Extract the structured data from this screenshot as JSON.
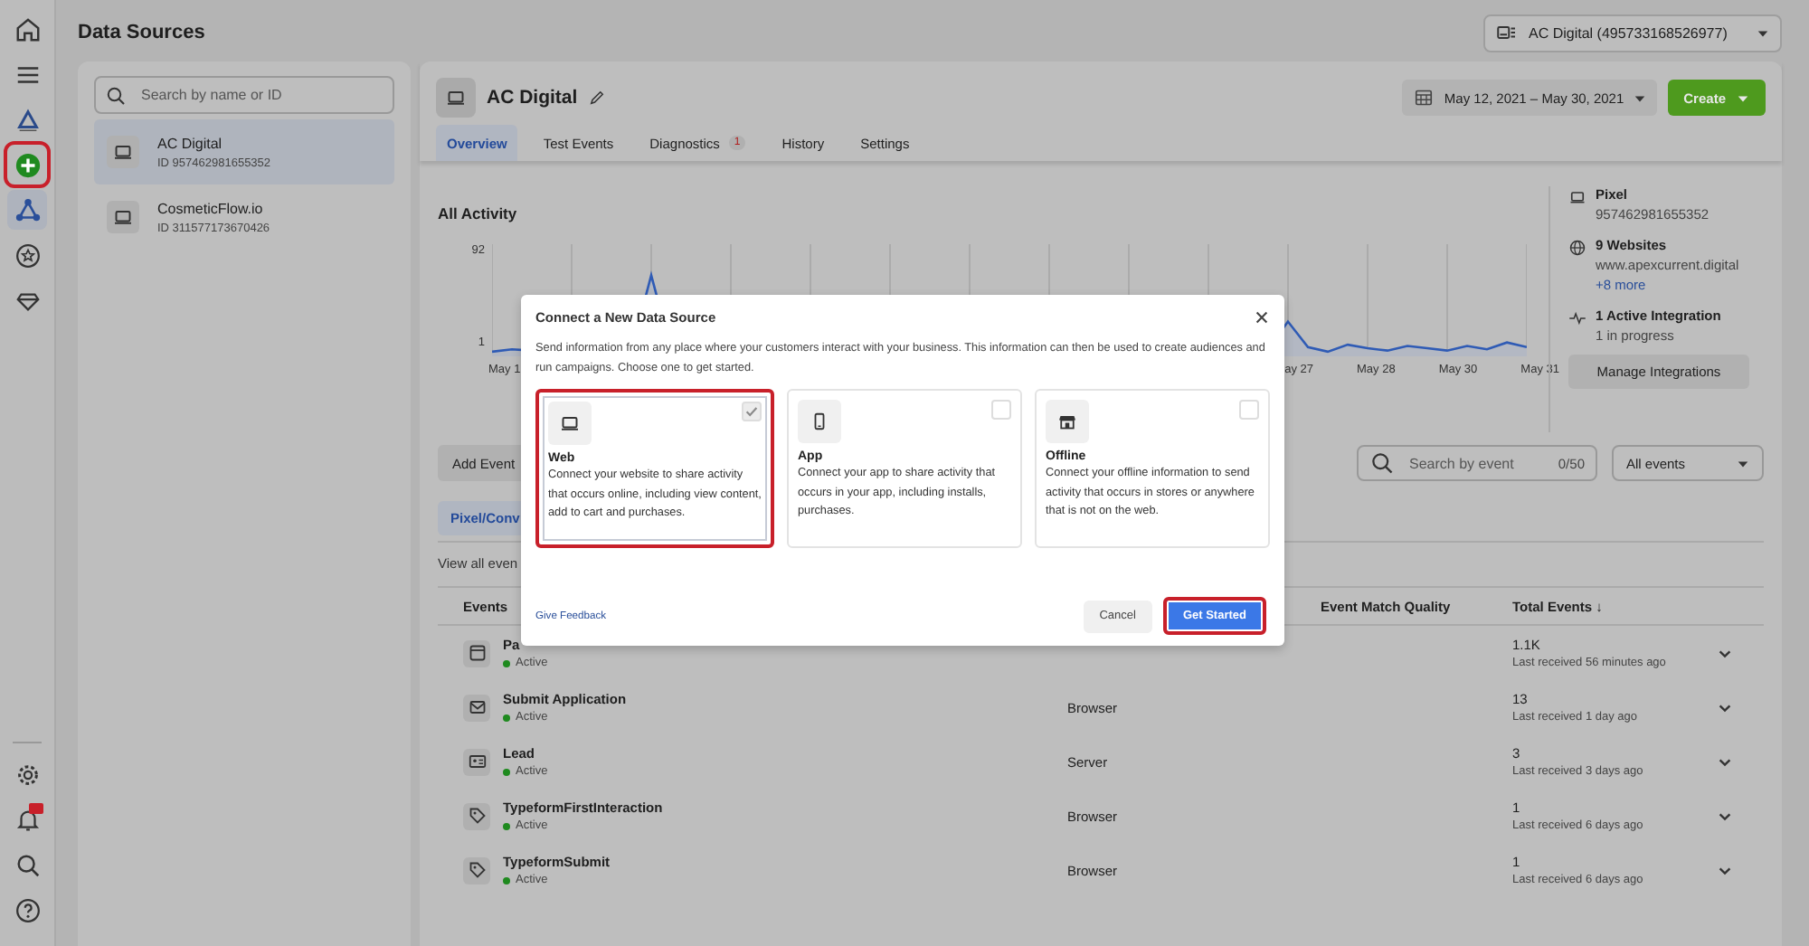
{
  "rail": {
    "items": [
      {
        "kind": "home",
        "selected": false,
        "highlighted": false
      },
      {
        "kind": "menu",
        "selected": false,
        "highlighted": false
      },
      {
        "kind": "logo",
        "selected": false,
        "highlighted": false
      },
      {
        "kind": "add",
        "selected": false,
        "highlighted": true
      },
      {
        "kind": "graph",
        "selected": true,
        "highlighted": false
      },
      {
        "kind": "star",
        "selected": false,
        "highlighted": false
      },
      {
        "kind": "gem",
        "selected": false,
        "highlighted": false
      }
    ],
    "bottom_items": [
      {
        "kind": "settings",
        "badge": false
      },
      {
        "kind": "bell",
        "badge": true
      },
      {
        "kind": "search",
        "badge": false
      },
      {
        "kind": "help",
        "badge": false
      }
    ]
  },
  "page_title": "Data Sources",
  "account_selector": {
    "label": "AC Digital (495733168526977)"
  },
  "sources_panel": {
    "search": {
      "placeholder": "Search by name or ID"
    },
    "items": [
      {
        "name": "AC Digital",
        "id": "ID 957462981655352",
        "selected": true
      },
      {
        "name": "CosmeticFlow.io",
        "id": "ID 311577173670426",
        "selected": false
      }
    ]
  },
  "header": {
    "title": "AC Digital",
    "date_range": "May 12, 2021 – May 30, 2021",
    "create": "Create"
  },
  "tabs": [
    {
      "label": "Overview",
      "selected": true
    },
    {
      "label": "Test Events",
      "selected": false
    },
    {
      "label": "Diagnostics",
      "selected": false,
      "badge": "1"
    },
    {
      "label": "History",
      "selected": false
    },
    {
      "label": "Settings",
      "selected": false
    }
  ],
  "activity": {
    "title": "All Activity",
    "y_labels": [
      "92",
      "1"
    ],
    "x_labels_left": [
      "May 1"
    ],
    "x_labels_right": [
      "ay 27",
      "May 28",
      "May 30",
      "May 31"
    ]
  },
  "info": [
    {
      "kind": "pixel",
      "title": "Pixel",
      "lines": [
        "957462981655352"
      ]
    },
    {
      "kind": "websites",
      "title": "9 Websites",
      "lines": [
        "www.apexcurrent.digital"
      ],
      "link": "+8 more"
    },
    {
      "kind": "integration",
      "title": "1 Active Integration",
      "lines": [
        "1 in progress"
      ]
    }
  ],
  "manage_button": "Manage Integrations",
  "events_toolbar": {
    "add_button": "Add Event",
    "search": {
      "placeholder": "Search by event",
      "counter": "0/50"
    },
    "filter": "All events"
  },
  "subtabs": [
    {
      "label": "Pixel/Conv",
      "selected": true
    }
  ],
  "view_all": "View all even",
  "table": {
    "columns": [
      "Events",
      "Event Match Quality",
      "Total Events ↓"
    ],
    "rows": [
      {
        "kind": "page",
        "name": "Pa",
        "status": "Active",
        "active": true,
        "total": "1.1K",
        "last": "Last received 56 minutes ago"
      },
      {
        "kind": "envelope",
        "name": "Submit Application",
        "status": "Active",
        "active": true,
        "column_2": "Browser",
        "total": "13",
        "last": "Last received 1 day ago"
      },
      {
        "kind": "card",
        "name": "Lead",
        "status": "Active",
        "active": true,
        "column_2": "Server",
        "total": "3",
        "last": "Last received 3 days ago"
      },
      {
        "kind": "tag",
        "name": "TypeformFirstInteraction",
        "status": "Active",
        "active": true,
        "column_2": "Browser",
        "total": "1",
        "last": "Last received 6 days ago"
      },
      {
        "kind": "tag",
        "name": "TypeformSubmit",
        "status": "Active",
        "active": true,
        "column_2": "Browser",
        "total": "1",
        "last": "Last received 6 days ago"
      }
    ]
  },
  "modal": {
    "title": "Connect a New Data Source",
    "description": "Send information from any place where your customers interact with your business. This information can then be used to create audiences and run campaigns. Choose one to get started.",
    "options": [
      {
        "kind": "web",
        "title": "Web",
        "description": "Connect your website to share activity that occurs online, including view content, add to cart and purchases.",
        "selected": true,
        "highlighted": true
      },
      {
        "kind": "app",
        "title": "App",
        "description": "Connect your app to share activity that occurs in your app, including installs, purchases.",
        "selected": false,
        "highlighted": false
      },
      {
        "kind": "offline",
        "title": "Offline",
        "description": "Connect your offline information to send activity that occurs in stores or anywhere that is not on the web.",
        "selected": false,
        "highlighted": false
      }
    ],
    "feedback": "Give Feedback",
    "cancel": "Cancel",
    "submit": {
      "label": "Get Started",
      "highlighted": true
    }
  }
}
